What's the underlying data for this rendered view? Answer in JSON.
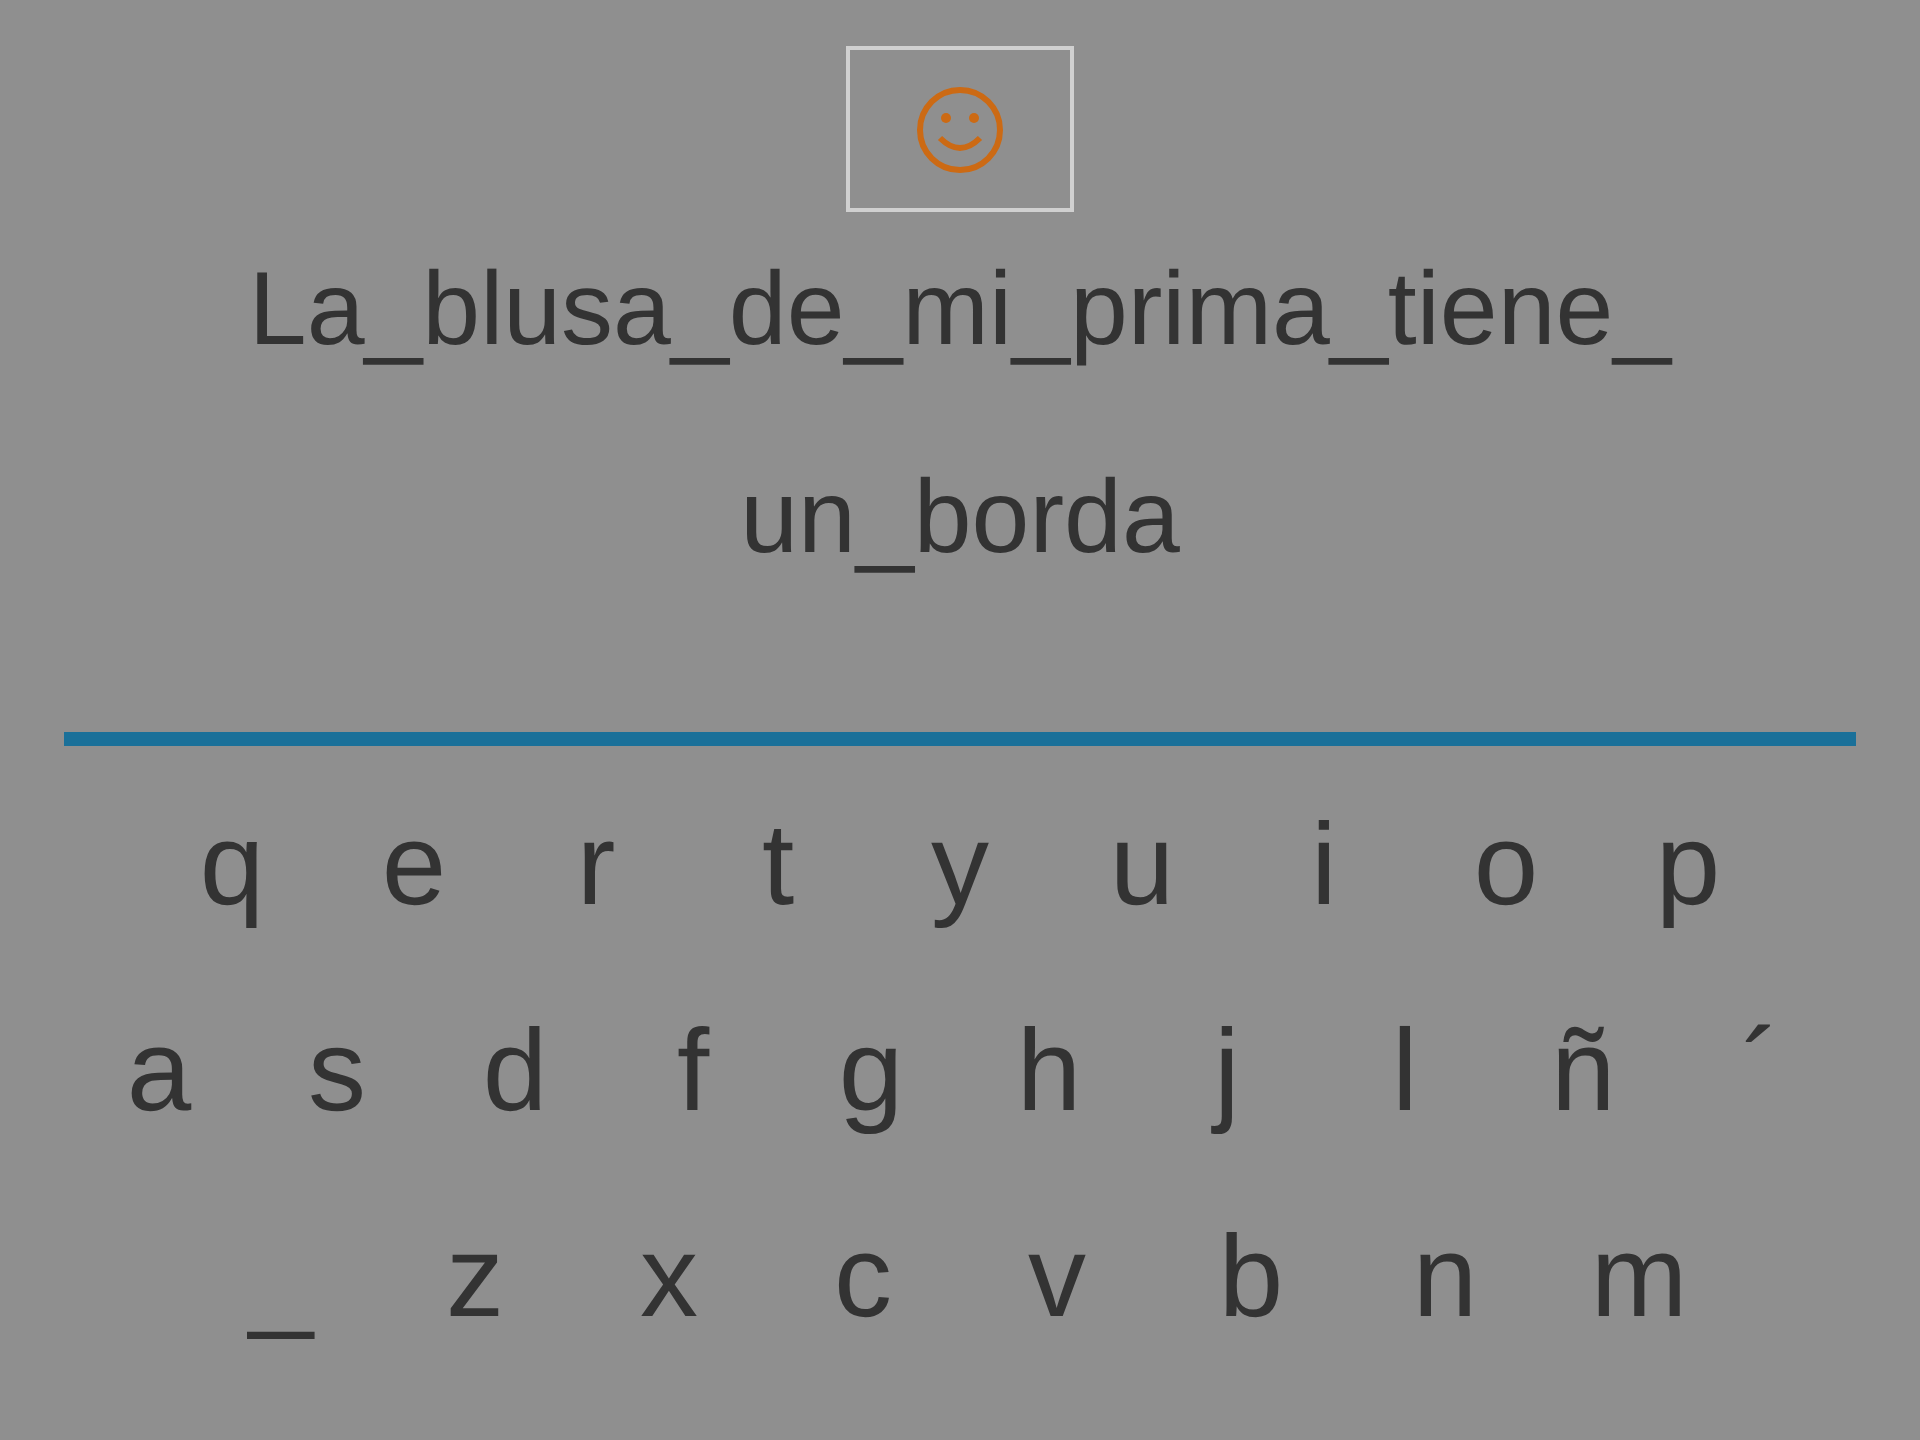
{
  "sentence_lines": [
    "La_blusa_de_mi_prima_tiene_",
    "un_borda"
  ],
  "keyboard_rows": [
    [
      "q",
      "e",
      "r",
      "t",
      "y",
      "u",
      "i",
      "o",
      "p"
    ],
    [
      "a",
      "s",
      "d",
      "f",
      "g",
      "h",
      "j",
      "l",
      "ñ",
      "´"
    ],
    [
      "_",
      "z",
      "x",
      "c",
      "v",
      "b",
      "n",
      "m"
    ]
  ]
}
